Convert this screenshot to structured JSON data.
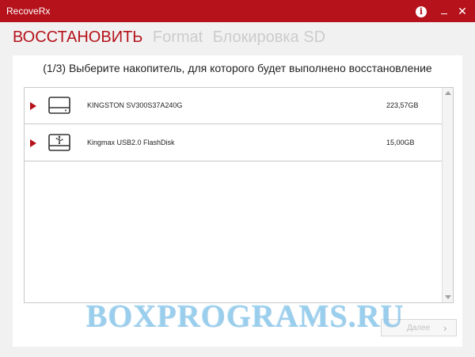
{
  "window": {
    "title": "RecoveRx",
    "controls": {
      "info_icon": "info-icon",
      "info_glyph": "i",
      "minimize_icon": "minimize-icon",
      "close_icon": "close-icon",
      "close_glyph": "✕"
    }
  },
  "tabs": [
    {
      "label": "ВОССТАНОВИТЬ",
      "active": true
    },
    {
      "label": "Format",
      "active": false
    },
    {
      "label": "Блокировка SD",
      "active": false
    }
  ],
  "main": {
    "instruction": "(1/3) Выберите накопитель, для которого будет выполнено восстановление",
    "drives": [
      {
        "name": "KINGSTON SV300S37A240G",
        "size": "223,57GB",
        "icon": "hard-drive-icon"
      },
      {
        "name": "Kingmax USB2.0 FlashDisk",
        "size": "15,00GB",
        "icon": "usb-drive-icon"
      }
    ],
    "next_button": {
      "label": "Далее",
      "chevron": "›",
      "enabled": false
    }
  },
  "watermark": "BOXPROGRAMS.RU",
  "colors": {
    "accent": "#b5121b",
    "inactive_tab": "#cccccc",
    "background": "#f1f1f1"
  }
}
